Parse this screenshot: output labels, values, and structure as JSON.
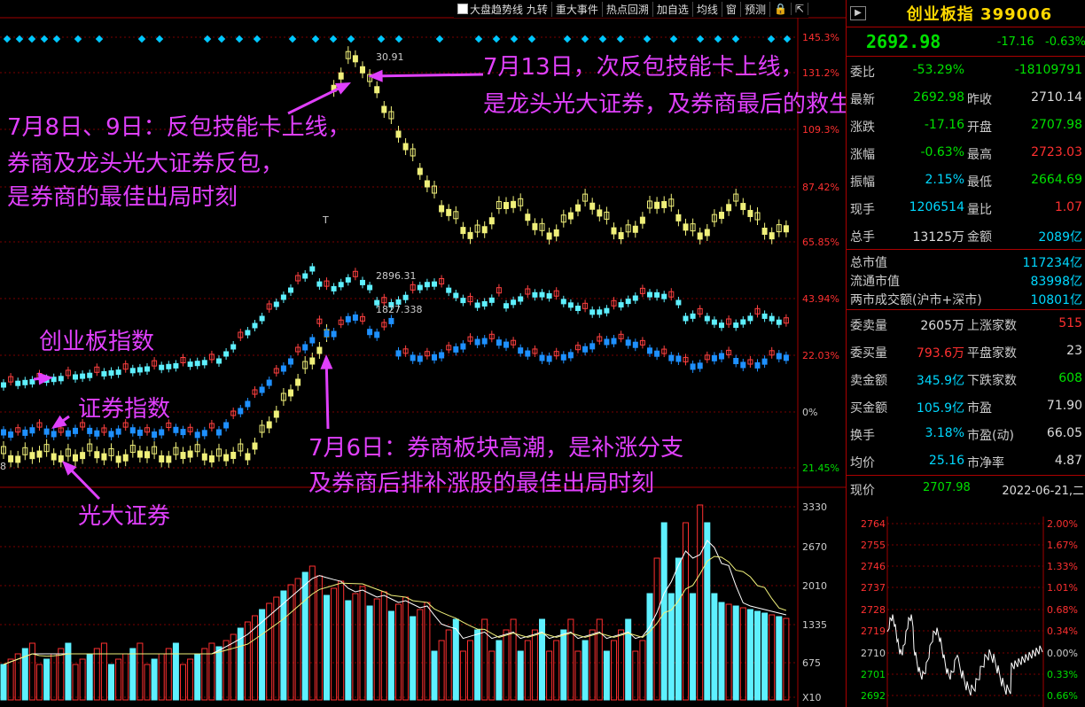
{
  "toolbar": {
    "items": [
      "大盘趋势线",
      "九转",
      "重大事件",
      "热点回溯",
      "加自选",
      "均线",
      "窗",
      "预测"
    ],
    "lock_icon": "lock-icon",
    "expand_icon": "expand-icon"
  },
  "main_axis": {
    "price_labels": [
      "145.3%",
      "131.2%",
      "109.3%",
      "87.42%",
      "65.85%",
      "43.94%",
      "22.03%",
      "0%",
      "21.45%"
    ],
    "volume_labels": [
      "3330",
      "2670",
      "2010",
      "1335",
      "675",
      "X10"
    ],
    "left_edge_label": "8"
  },
  "chart_labels": {
    "peak_gd": "30.91",
    "peak_cyb": "2896.31",
    "peak_zq": "1827.338",
    "low_marker": "T"
  },
  "annotations": {
    "jul13_line1": "7月13日，次反包技能卡上线，",
    "jul13_line2": "是龙头光大证券，及券商最后的救生机",
    "jul89_line1": "7月8日、9日：反包技能卡上线，",
    "jul89_line2": "券商及龙头光大证券反包，",
    "jul89_line3": "是券商的最佳出局时刻",
    "jul6_line1": "7月6日：券商板块高潮，是补涨分支",
    "jul6_line2": "及券商后排补涨股的最佳出局时刻",
    "label_cyb": "创业板指数",
    "label_zq": "证券指数",
    "label_gd": "光大证券"
  },
  "panel": {
    "title": "创业板指 399006",
    "price": "2692.98",
    "change": "-17.16",
    "change_pct": "-0.63%",
    "rows": [
      {
        "l1": "委比",
        "v1": "-53.29%",
        "c1": "g",
        "l2": "",
        "v2": "-18109791",
        "c2": "g"
      },
      {
        "l1": "最新",
        "v1": "2692.98",
        "c1": "g",
        "l2": "昨收",
        "v2": "2710.14",
        "c2": "w"
      },
      {
        "l1": "涨跌",
        "v1": "-17.16",
        "c1": "g",
        "l2": "开盘",
        "v2": "2707.98",
        "c2": "g"
      },
      {
        "l1": "涨幅",
        "v1": "-0.63%",
        "c1": "g",
        "l2": "最高",
        "v2": "2723.03",
        "c2": "r"
      },
      {
        "l1": "振幅",
        "v1": "2.15%",
        "c1": "c",
        "l2": "最低",
        "v2": "2664.69",
        "c2": "g"
      },
      {
        "l1": "现手",
        "v1": "1206514",
        "c1": "c",
        "l2": "量比",
        "v2": "1.07",
        "c2": "r"
      },
      {
        "l1": "总手",
        "v1": "13125万",
        "c1": "w",
        "l2": "金额",
        "v2": "2089亿",
        "c2": "c"
      }
    ],
    "cap_rows": [
      {
        "l": "总市值",
        "v": "117234亿"
      },
      {
        "l": "流通市值",
        "v": "83998亿"
      },
      {
        "l": "两市成交额(沪市+深市)",
        "v": "10801亿"
      }
    ],
    "rows2": [
      {
        "l1": "委卖量",
        "v1": "2605万",
        "c1": "w",
        "l2": "上涨家数",
        "v2": "515",
        "c2": "r"
      },
      {
        "l1": "委买量",
        "v1": "793.6万",
        "c1": "r",
        "l2": "平盘家数",
        "v2": "23",
        "c2": "w"
      },
      {
        "l1": "卖金额",
        "v1": "345.9亿",
        "c1": "c",
        "l2": "下跌家数",
        "v2": "608",
        "c2": "g"
      },
      {
        "l1": "买金额",
        "v1": "105.9亿",
        "c1": "c",
        "l2": "市盈",
        "v2": "71.90",
        "c2": "w"
      },
      {
        "l1": "换手",
        "v1": "3.18%",
        "c1": "c",
        "l2": "市盈(动)",
        "v2": "66.05",
        "c2": "w"
      },
      {
        "l1": "均价",
        "v1": "25.16",
        "c1": "c",
        "l2": "市净率",
        "v2": "4.87",
        "c2": "w"
      }
    ],
    "now_label": "现价",
    "now_price": "2707.98",
    "date": "2022-06-21,二",
    "mini_left": [
      "2764",
      "2755",
      "2746",
      "2737",
      "2728",
      "2719",
      "2710",
      "2701",
      "2692"
    ],
    "mini_right": [
      "2.00%",
      "1.67%",
      "1.33%",
      "1.01%",
      "0.68%",
      "0.34%",
      "0.00%",
      "0.33%",
      "0.66%"
    ]
  },
  "colors": {
    "up": "#ff3030",
    "down": "#00e000",
    "annotation": "#e040fb",
    "gd_candle": "#f0f07a",
    "cyb_up": "#ff4040",
    "cyb_down": "#5ef0ff",
    "zq_down": "#1e90ff"
  }
}
